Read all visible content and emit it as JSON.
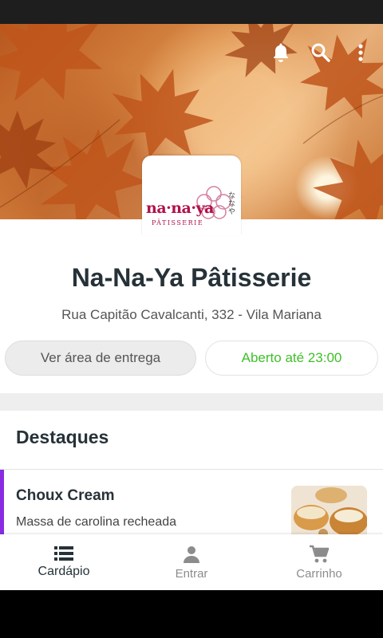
{
  "header": {
    "icons": [
      "bell-icon",
      "search-icon",
      "more-vertical-icon"
    ]
  },
  "logo": {
    "text": "na·na·ya",
    "subtitle": "PÂTISSERIE",
    "kana": "なな や"
  },
  "store": {
    "name": "Na-Na-Ya Pâtisserie",
    "address": "Rua Capitão Cavalcanti, 332 - Vila Mariana"
  },
  "actions": {
    "delivery_label": "Ver área de entrega",
    "open_label": "Aberto até 23:00",
    "open_color": "#3fbf2a"
  },
  "highlights": {
    "title": "Destaques",
    "products": [
      {
        "name": "Choux Cream",
        "description": "Massa de carolina recheada"
      }
    ]
  },
  "bottom_nav": {
    "items": [
      {
        "label": "Cardápio",
        "icon": "menu-list-icon",
        "active": true
      },
      {
        "label": "Entrar",
        "icon": "person-icon",
        "active": false
      },
      {
        "label": "Carrinho",
        "icon": "cart-icon",
        "active": false
      }
    ]
  },
  "colors": {
    "accent": "#8a2be2",
    "title": "#263238"
  }
}
